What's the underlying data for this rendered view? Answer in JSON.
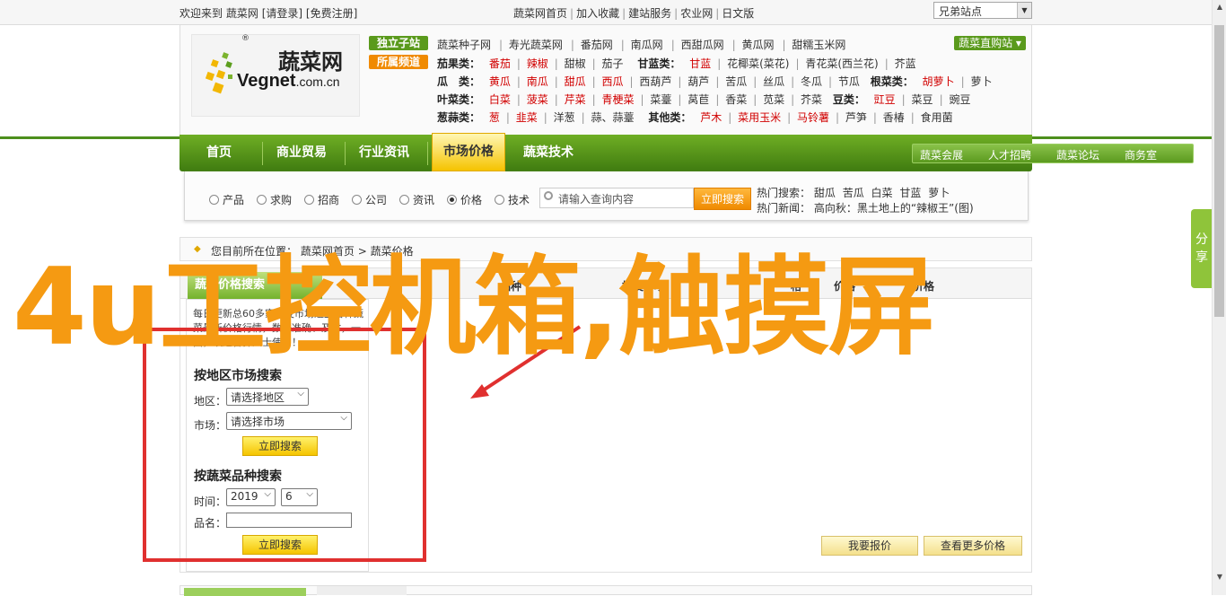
{
  "topbar": {
    "welcome": "欢迎来到",
    "site": "蔬菜网",
    "login": "[请登录]",
    "register": "[免费注册]",
    "links": [
      "蔬菜网首页",
      "加入收藏",
      "建站服务",
      "农业网",
      "日文版"
    ],
    "sister_select": "兄弟站点"
  },
  "logo": {
    "cn": "蔬菜网",
    "en_main": "Vegnet",
    "en_tail": ".com.cn",
    "reg": "®"
  },
  "tags": {
    "independent": "独立子站",
    "subchannel": "所属频道"
  },
  "sub_sites": [
    "蔬菜种子网",
    "寿光蔬菜网",
    "番茄网",
    "南瓜网",
    "西甜瓜网",
    "黄瓜网",
    "甜糯玉米网"
  ],
  "direct_button": "蔬菜直购站 ▾",
  "veg_rows": {
    "r1_label": "茄果类：",
    "r1": [
      "番茄",
      "辣椒",
      "甜椒",
      "茄子"
    ],
    "r1b_label": "甘蓝类：",
    "r1b": [
      "甘蓝",
      "花椰菜(菜花)",
      "青花菜(西兰花)",
      "芥蓝"
    ],
    "r2_label": "瓜　类：",
    "r2": [
      "黄瓜",
      "南瓜",
      "甜瓜",
      "西瓜",
      "西葫芦",
      "葫芦",
      "苦瓜",
      "丝瓜",
      "冬瓜",
      "节瓜"
    ],
    "r2b_label": "根菜类：",
    "r2b": [
      "胡萝卜",
      "萝卜"
    ],
    "r3_label": "叶菜类：",
    "r3": [
      "白菜",
      "菠菜",
      "芹菜",
      "青梗菜",
      "菜薹",
      "莴苣",
      "香菜",
      "苋菜",
      "芥菜"
    ],
    "r3b_label": "豆类：",
    "r3b": [
      "豇豆",
      "菜豆",
      "豌豆"
    ],
    "r4_label": "葱蒜类：",
    "r4": [
      "葱",
      "韭菜",
      "洋葱",
      "蒜、蒜薹"
    ],
    "r4b_label": "其他类：",
    "r4b": [
      "芦木",
      "菜用玉米",
      "马铃薯",
      "芦笋",
      "香椿",
      "食用菌"
    ]
  },
  "nav": {
    "items": [
      "首页",
      "商业贸易",
      "行业资讯",
      "市场价格",
      "蔬菜技术"
    ],
    "sub": [
      "蔬菜会展",
      "人才招聘",
      "蔬菜论坛",
      "商务室"
    ]
  },
  "search": {
    "radios": [
      "产品",
      "求购",
      "招商",
      "公司",
      "资讯",
      "价格",
      "技术"
    ],
    "selected": "价格",
    "placeholder": "请输入查询内容",
    "button": "立即搜索",
    "hot_label": "热门搜索：",
    "hot": [
      "甜瓜",
      "苦瓜",
      "白菜",
      "甘蓝",
      "萝卜"
    ],
    "news_label": "热门新闻：",
    "news": "高向秋：黑土地上的“辣椒王”(图)"
  },
  "share": "分享",
  "breadcrumb": {
    "label": "您目前所在位置：",
    "home": "蔬菜网首页",
    "sep": ">",
    "current": "蔬菜价格"
  },
  "panel": {
    "tab_active": "蔬菜价格搜索",
    "tabs": [
      "品种",
      "批发市场",
      "格",
      "价格",
      "价格"
    ],
    "intro": "每日更新总60多家批发市场近上百种蔬菜最新价格行情，数据准确、及时，一面，欢迎各界人士使用！",
    "region_title": "按地区市场搜索",
    "region_label": "地区：",
    "region_value": "请选择地区",
    "market_label": "市场：",
    "market_value": "请选择市场",
    "search_btn": "立即搜索",
    "variety_title": "按蔬菜品种搜索",
    "time_label": "时间：",
    "year": "2019",
    "month": "6",
    "name_label": "品名：",
    "quote_btn": "我要报价",
    "more_btn": "查看更多价格"
  },
  "overlay_text": "4u工控机箱,触摸屏",
  "colors": {
    "nav_green": "#4d8f1c",
    "accent_orange": "#f59a12",
    "highlight_red": "#e0302f",
    "yellow": "#f5c400"
  }
}
